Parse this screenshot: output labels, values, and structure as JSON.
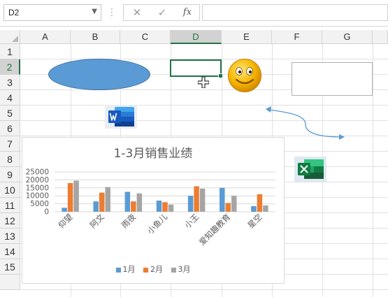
{
  "formula_bar": {
    "name_box": "D2",
    "cancel_icon": "✕",
    "enter_icon": "✓",
    "fx_label": "fx",
    "formula_value": ""
  },
  "columns": [
    "A",
    "B",
    "C",
    "D",
    "E",
    "F",
    "G"
  ],
  "selected_column": "D",
  "rows": [
    "1",
    "2",
    "3",
    "4",
    "5",
    "6",
    "7",
    "8",
    "9",
    "10",
    "11",
    "12",
    "13",
    "14",
    "15"
  ],
  "selected_row": "2",
  "colors": {
    "excel_green": "#217346",
    "ellipse_fill": "#5b9bd5",
    "series_1": "#5b9bd5",
    "series_2": "#ed7d31",
    "series_3": "#a5a5a5"
  },
  "shapes": {
    "ellipse": "blue-ellipse",
    "smiley": "smiley-icon",
    "rectangle": "empty-rectangle",
    "arrow": "curved-double-arrow",
    "word": "word-icon",
    "excel": "excel-icon"
  },
  "chart_data": {
    "type": "bar",
    "title": "1-3月销售业绩",
    "categories": [
      "仰望",
      "阿文",
      "雨夜",
      "小鱼儿",
      "小王",
      "爱知趣教育",
      "星空"
    ],
    "series": [
      {
        "name": "1月",
        "values": [
          2500,
          6500,
          12500,
          7000,
          10000,
          15000,
          3500
        ]
      },
      {
        "name": "2月",
        "values": [
          18000,
          12000,
          6500,
          6000,
          16000,
          5500,
          11000
        ]
      },
      {
        "name": "3月",
        "values": [
          19500,
          15500,
          11500,
          4500,
          14500,
          10000,
          4000
        ]
      }
    ],
    "y_ticks": [
      "25000",
      "20000",
      "15000",
      "10000",
      "5000",
      "0"
    ],
    "ylim": [
      0,
      25000
    ],
    "grid": true,
    "legend_position": "bottom"
  }
}
